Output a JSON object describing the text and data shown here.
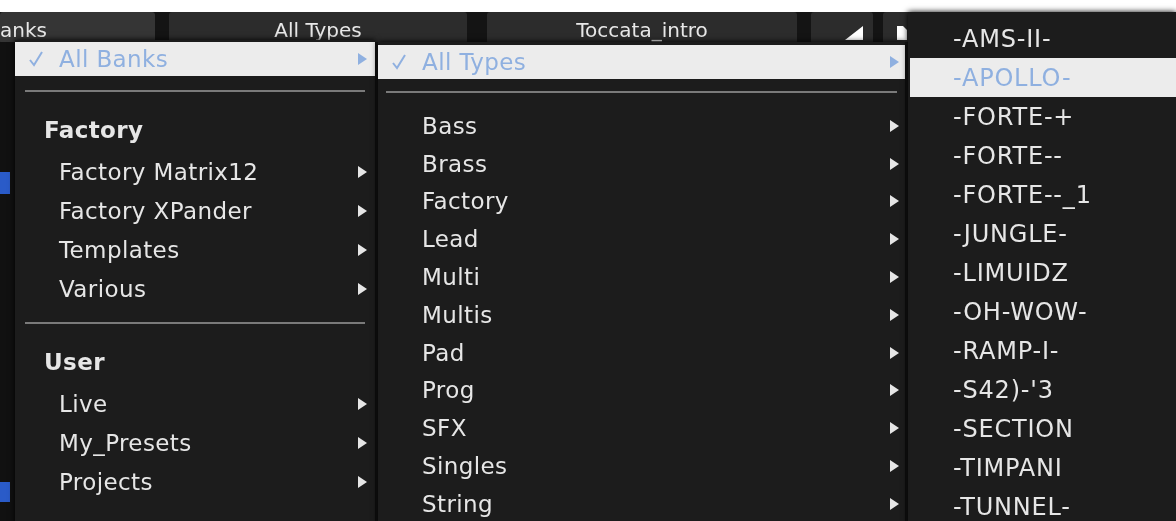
{
  "toolbar": {
    "buttons": [
      {
        "label": "anks"
      },
      {
        "label": "All Types"
      },
      {
        "label": "Toccata_intro"
      }
    ]
  },
  "menus": [
    {
      "items": [
        {
          "kind": "item",
          "label": "All Banks",
          "checked": true,
          "selected": true,
          "submenu": true
        },
        {
          "kind": "separator"
        },
        {
          "kind": "header",
          "label": "Factory"
        },
        {
          "kind": "item",
          "label": "Factory Matrix12",
          "checked": false,
          "selected": false,
          "submenu": true
        },
        {
          "kind": "item",
          "label": "Factory XPander",
          "checked": false,
          "selected": false,
          "submenu": true
        },
        {
          "kind": "item",
          "label": "Templates",
          "checked": false,
          "selected": false,
          "submenu": true
        },
        {
          "kind": "item",
          "label": "Various",
          "checked": false,
          "selected": false,
          "submenu": true
        },
        {
          "kind": "separator"
        },
        {
          "kind": "header",
          "label": "User"
        },
        {
          "kind": "item",
          "label": "Live",
          "checked": false,
          "selected": false,
          "submenu": true
        },
        {
          "kind": "item",
          "label": "My_Presets",
          "checked": false,
          "selected": false,
          "submenu": true
        },
        {
          "kind": "item",
          "label": "Projects",
          "checked": false,
          "selected": false,
          "submenu": true
        }
      ]
    },
    {
      "items": [
        {
          "kind": "item",
          "label": "All Types",
          "checked": true,
          "selected": true,
          "submenu": true
        },
        {
          "kind": "separator"
        },
        {
          "kind": "item",
          "label": "Bass",
          "checked": false,
          "selected": false,
          "submenu": true
        },
        {
          "kind": "item",
          "label": "Brass",
          "checked": false,
          "selected": false,
          "submenu": true
        },
        {
          "kind": "item",
          "label": "Factory",
          "checked": false,
          "selected": false,
          "submenu": true
        },
        {
          "kind": "item",
          "label": "Lead",
          "checked": false,
          "selected": false,
          "submenu": true
        },
        {
          "kind": "item",
          "label": "Multi",
          "checked": false,
          "selected": false,
          "submenu": true
        },
        {
          "kind": "item",
          "label": "Multis",
          "checked": false,
          "selected": false,
          "submenu": true
        },
        {
          "kind": "item",
          "label": "Pad",
          "checked": false,
          "selected": false,
          "submenu": true
        },
        {
          "kind": "item",
          "label": "Prog",
          "checked": false,
          "selected": false,
          "submenu": true
        },
        {
          "kind": "item",
          "label": "SFX",
          "checked": false,
          "selected": false,
          "submenu": true
        },
        {
          "kind": "item",
          "label": "Singles",
          "checked": false,
          "selected": false,
          "submenu": true
        },
        {
          "kind": "item",
          "label": "String",
          "checked": false,
          "selected": false,
          "submenu": true
        }
      ]
    },
    {
      "items": [
        {
          "kind": "item",
          "label": "-AMS-II-",
          "checked": false,
          "selected": false,
          "submenu": false
        },
        {
          "kind": "item",
          "label": "-APOLLO-",
          "checked": false,
          "selected": true,
          "submenu": false
        },
        {
          "kind": "item",
          "label": "-FORTE-+",
          "checked": false,
          "selected": false,
          "submenu": false
        },
        {
          "kind": "item",
          "label": "-FORTE--",
          "checked": false,
          "selected": false,
          "submenu": false
        },
        {
          "kind": "item",
          "label": "-FORTE--_1",
          "checked": false,
          "selected": false,
          "submenu": false
        },
        {
          "kind": "item",
          "label": "-JUNGLE-",
          "checked": false,
          "selected": false,
          "submenu": false
        },
        {
          "kind": "item",
          "label": "-LIMUIDZ",
          "checked": false,
          "selected": false,
          "submenu": false
        },
        {
          "kind": "item",
          "label": "-OH-WOW-",
          "checked": false,
          "selected": false,
          "submenu": false
        },
        {
          "kind": "item",
          "label": "-RAMP-I-",
          "checked": false,
          "selected": false,
          "submenu": false
        },
        {
          "kind": "item",
          "label": "-S42)-'3",
          "checked": false,
          "selected": false,
          "submenu": false
        },
        {
          "kind": "item",
          "label": "-SECTION",
          "checked": false,
          "selected": false,
          "submenu": false
        },
        {
          "kind": "item",
          "label": "-TIMPANI",
          "checked": false,
          "selected": false,
          "submenu": false
        },
        {
          "kind": "item",
          "label": "-TUNNEL-",
          "checked": false,
          "selected": false,
          "submenu": false
        }
      ]
    }
  ]
}
